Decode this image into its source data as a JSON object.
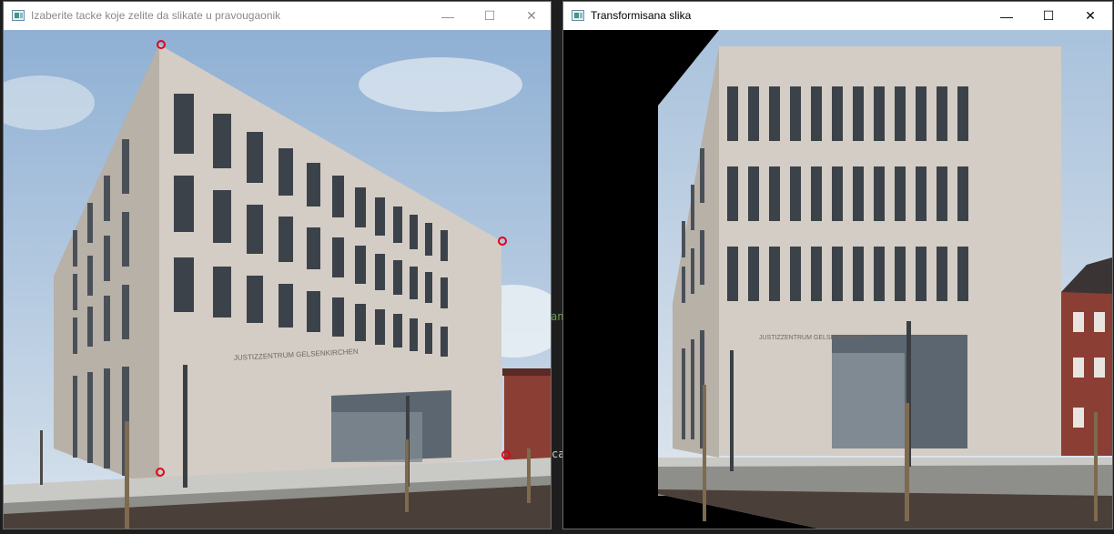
{
  "window_left": {
    "title": "Izaberite tacke koje zelite da slikate u pravougaonik",
    "controls": {
      "minimize": "—",
      "maximize": "☐",
      "close": "✕"
    },
    "building_sign": "JUSTIZZENTRUM GELSENKIRCHEN",
    "selected_points": 4
  },
  "window_right": {
    "title": "Transformisana slika",
    "controls": {
      "minimize": "—",
      "maximize": "☐",
      "close": "✕"
    },
    "building_sign": "JUSTIZZENTRUM GELSENKIRCHEN"
  },
  "background": {
    "peek_text_1": "an",
    "peek_text_2": "ca"
  },
  "colors": {
    "marker": "#e0001a",
    "sky": "#9fbad6",
    "facade": "#cfc9c1",
    "window_dark": "#3c4249",
    "pavement": "#c9c9c6",
    "asphalt": "#4a4039"
  },
  "icons": [
    "app-window-icon",
    "minimize-icon",
    "maximize-icon",
    "close-icon"
  ]
}
